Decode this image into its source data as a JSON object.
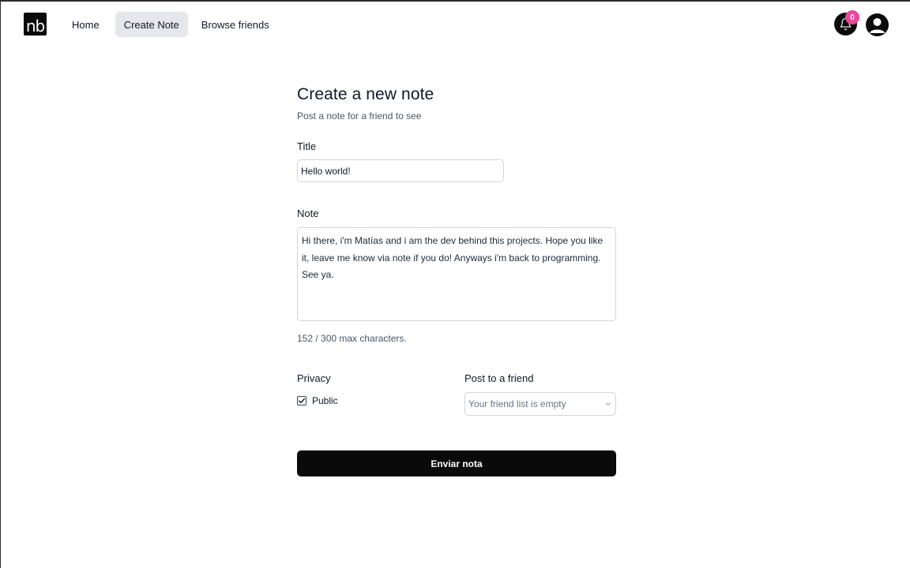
{
  "header": {
    "logo_text": "nb",
    "nav": [
      {
        "label": "Home",
        "active": false
      },
      {
        "label": "Create Note",
        "active": true
      },
      {
        "label": "Browse friends",
        "active": false
      }
    ],
    "notification_count": "0"
  },
  "form": {
    "heading": "Create a new note",
    "subheading": "Post a note for a friend to see",
    "title_label": "Title",
    "title_value": "Hello world!",
    "note_label": "Note",
    "note_value": "Hi there, i'm Matías and i am the dev behind this projects. Hope you like it, leave me know via note if you do! Anyways i'm back to programming. See ya.",
    "counter_text": "152 / 300 max characters.",
    "privacy_label": "Privacy",
    "public_checkbox": {
      "label": "Public",
      "checked": true
    },
    "friend_label": "Post to a friend",
    "friend_select_value": "Your friend list is empty",
    "submit_label": "Enviar nota"
  },
  "colors": {
    "primary": "#0a0a0a",
    "badge": "#ec4899",
    "active_nav_bg": "#e5e7eb",
    "border": "#d1d5db"
  }
}
